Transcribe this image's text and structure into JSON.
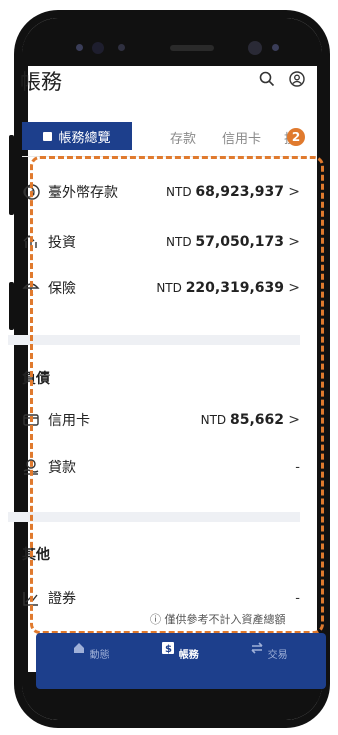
{
  "header": {
    "title": "帳務",
    "search_icon": "search-icon",
    "account_icon": "account-icon"
  },
  "tabs": {
    "active": "帳務總覽",
    "items": [
      "存款",
      "信用卡",
      "投"
    ]
  },
  "badge": "2",
  "assets": [
    {
      "icon": "foreign-deposit-icon",
      "label": "臺外幣存款",
      "currency": "NTD",
      "amount": "68,923,937",
      "chevron": ">"
    },
    {
      "icon": "investment-icon",
      "label": "投資",
      "currency": "NTD",
      "amount": "57,050,173",
      "chevron": ">"
    },
    {
      "icon": "insurance-icon",
      "label": "保險",
      "currency": "NTD",
      "amount": "220,319,639",
      "chevron": ">"
    }
  ],
  "liabilities": {
    "title": "負債",
    "items": [
      {
        "icon": "credit-card-icon",
        "label": "信用卡",
        "currency": "NTD",
        "amount": "85,662",
        "chevron": ">"
      },
      {
        "icon": "loan-icon",
        "label": "貸款",
        "value": "-"
      }
    ]
  },
  "others": {
    "title": "其他",
    "items": [
      {
        "icon": "securities-chart-icon",
        "label": "證券",
        "value": "-"
      }
    ]
  },
  "note": "ⓘ 僅供參考不計入資產總額",
  "bottom_nav": [
    {
      "icon": "home-icon",
      "label": "動態"
    },
    {
      "icon": "dollar-icon",
      "label": "帳務"
    },
    {
      "icon": "transfer-icon",
      "label": "交易"
    }
  ],
  "colors": {
    "brand": "#1d3f8c",
    "highlight": "#e07a2e"
  }
}
